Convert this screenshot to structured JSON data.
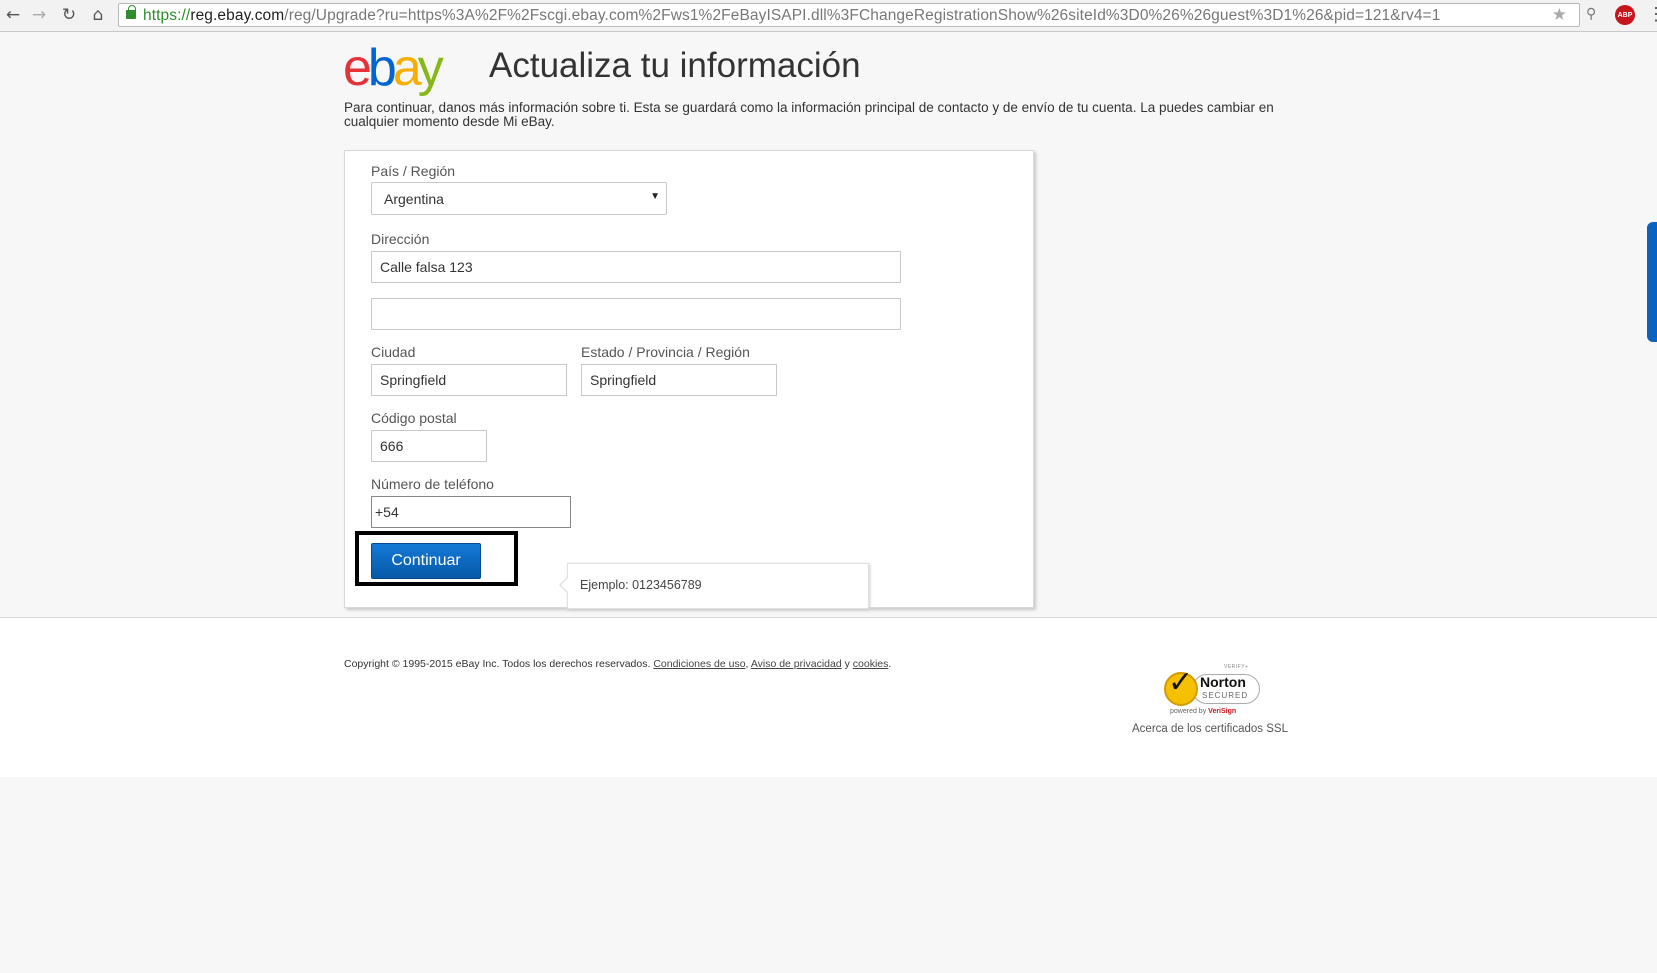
{
  "browser": {
    "url_scheme": "https://",
    "url_host": "reg.ebay.com",
    "url_path": "/reg/Upgrade?ru=https%3A%2F%2Fscgi.ebay.com%2Fws1%2FeBayISAPI.dll%3FChangeRegistrationShow%26siteId%3D0%26%26guest%3D1%26&pid=121&rv4=1",
    "abp_label": "ABP",
    "icons": [
      "back-icon",
      "forward-icon",
      "reload-icon",
      "home-icon",
      "lock-icon",
      "star-icon",
      "key-icon",
      "adblock-icon",
      "menu-icon"
    ]
  },
  "header": {
    "logo": {
      "e": "e",
      "b": "b",
      "a": "a",
      "y": "y"
    },
    "title": "Actualiza tu información",
    "intro": "Para continuar, danos más información sobre ti. Esta se guardará como la información principal de contacto y de envío de tu cuenta. La puedes cambiar en cualquier momento desde Mi eBay."
  },
  "form": {
    "country_label": "País / Región",
    "country_value": "Argentina",
    "address_label": "Dirección",
    "address1_value": "Calle falsa 123",
    "address2_value": "",
    "city_label": "Ciudad",
    "city_value": "Springfield",
    "state_label": "Estado / Provincia / Región",
    "state_value": "Springfield",
    "zip_label": "Código postal",
    "zip_value": "666",
    "phone_label": "Número de teléfono",
    "phone_value": "+54",
    "continue_label": "Continuar",
    "phone_tooltip": "Ejemplo: 0123456789"
  },
  "footer": {
    "copyright": "Copyright © 1995-2015 eBay Inc. Todos los derechos reservados.",
    "terms_link": "Condiciones de uso",
    "comma": ",",
    "privacy_link": "Aviso de privacidad",
    "and": "y",
    "cookies_link": "cookies",
    "period": ".",
    "norton_name": "Norton",
    "norton_secured": "SECURED",
    "norton_powered": "powered by",
    "norton_verisign": "VeriSign",
    "norton_verify": "VERIFY+",
    "ssl_link": "Acerca de los certificados SSL"
  },
  "colors": {
    "ebay_red": "#e53238",
    "ebay_blue": "#0064d2",
    "ebay_yellow": "#f5af02",
    "ebay_green": "#86b817",
    "button_blue": "#0659a8",
    "url_secure_green": "#2d8c2d"
  }
}
